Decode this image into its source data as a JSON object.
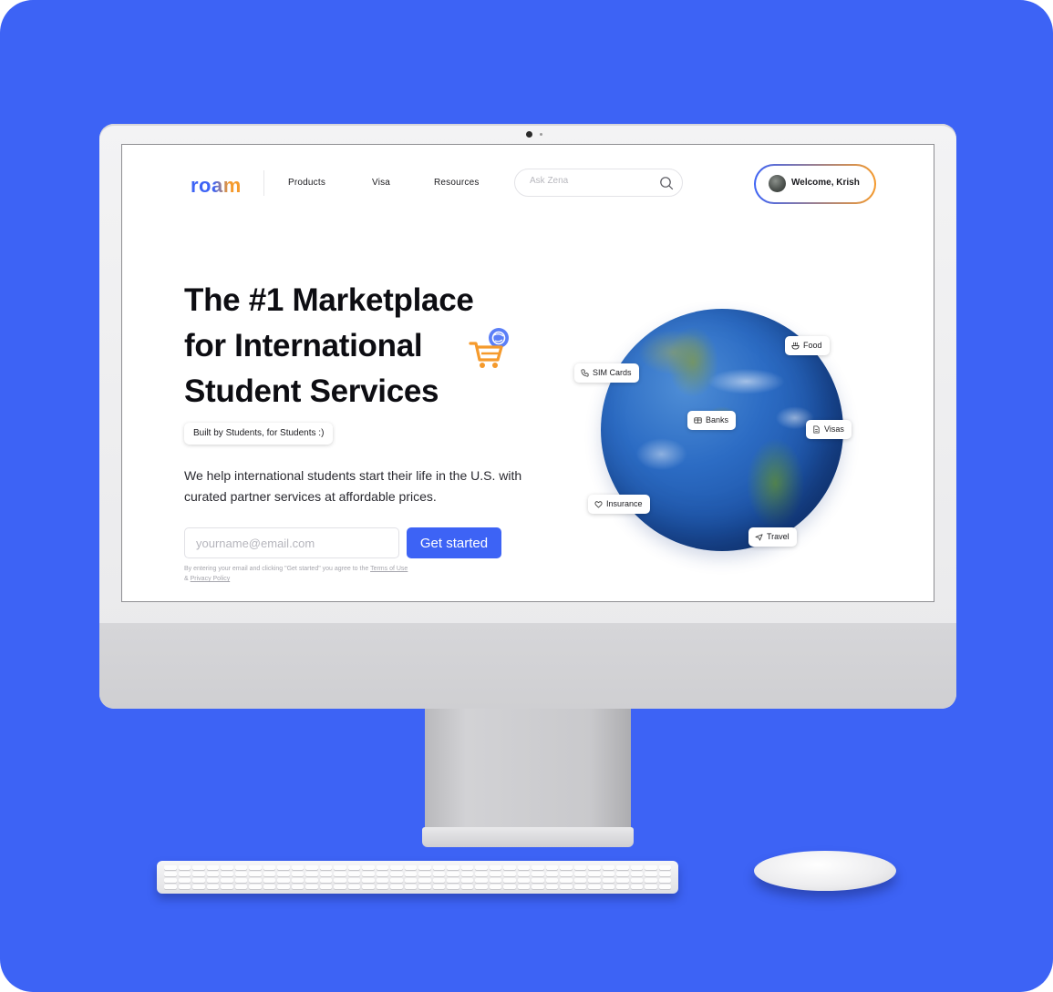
{
  "nav": {
    "logo": "roam",
    "links": [
      "Products",
      "Visa",
      "Resources"
    ],
    "search_placeholder": "Ask Zena",
    "welcome": "Welcome, Krish"
  },
  "hero": {
    "headline_lines": [
      "The #1 Marketplace",
      "for International",
      "Student Services"
    ],
    "pill": "Built by Students, for Students :)",
    "subtext": "We help international students start their life in the U.S. with curated partner services at affordable prices.",
    "email_placeholder": "yourname@email.com",
    "cta": "Get started",
    "legal_prefix": "By entering your email and clicking \"Get started\" you agree to the",
    "legal_terms": "Terms of Use",
    "legal_and": "&",
    "legal_privacy": "Privacy Policy"
  },
  "globe_tags": {
    "food": "Food",
    "sim_cards": "SIM Cards",
    "banks": "Banks",
    "visas": "Visas",
    "insurance": "Insurance",
    "travel": "Travel"
  },
  "colors": {
    "background": "#3d63f5",
    "accent_blue": "#3d63f5",
    "accent_orange": "#f59a2c"
  }
}
